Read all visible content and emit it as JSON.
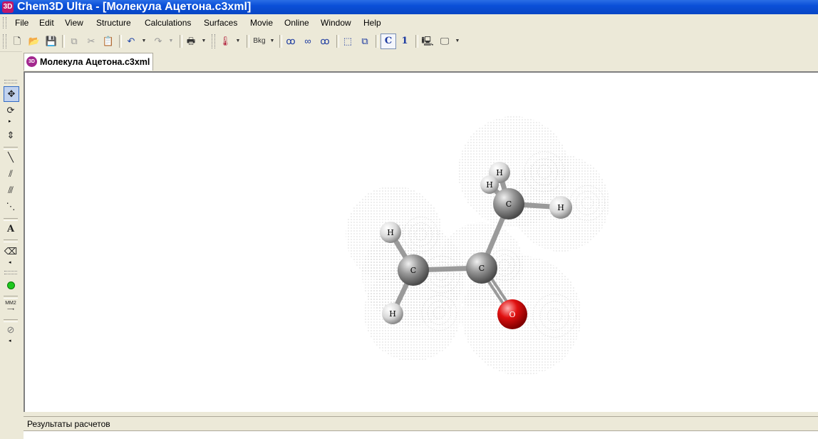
{
  "window": {
    "title": "Chem3D Ultra - [Молекула Ацетона.c3xml]",
    "app_icon_text": "3D"
  },
  "menu": [
    "File",
    "Edit",
    "View",
    "Structure",
    "Calculations",
    "Surfaces",
    "Movie",
    "Online",
    "Window",
    "Help"
  ],
  "toolbar": {
    "new": "🗋",
    "open": "📂",
    "save": "💾",
    "copy": "⧉",
    "cut": "✂",
    "paste": "📋",
    "undo": "↶",
    "redo": "↷",
    "print": "🖶",
    "thermometer": "🌡",
    "bkg": "Bkg",
    "element_label": "C",
    "number_label": "1"
  },
  "document": {
    "tab_label": "Молекула Ацетона.c3xml",
    "tab_icon_text": "3D"
  },
  "palette": {
    "text_tool": "A",
    "mm2_label": "MM2"
  },
  "molecule": {
    "atoms": [
      {
        "label": "C"
      },
      {
        "label": "C"
      },
      {
        "label": "C"
      },
      {
        "label": "O"
      },
      {
        "label": "H"
      },
      {
        "label": "H"
      },
      {
        "label": "H"
      },
      {
        "label": "H"
      },
      {
        "label": "H"
      }
    ],
    "colors": {
      "carbon": "#8a8a8a",
      "hydrogen": "#e6e6e6",
      "oxygen": "#e01010",
      "bond": "#9a9a9a",
      "surface_dots": "#7a7a7a"
    }
  },
  "results_pane": {
    "title": "Результаты расчетов"
  }
}
